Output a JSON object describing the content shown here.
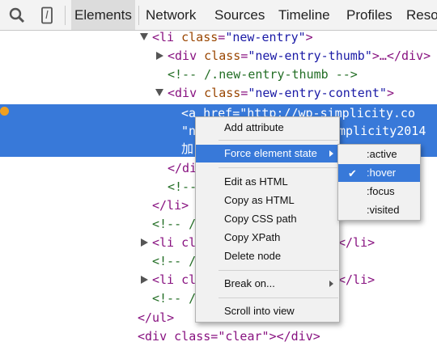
{
  "toolbar": {
    "search_icon": "search-icon",
    "device_icon": "mobile-device-icon",
    "tabs": [
      {
        "label": "Elements",
        "active": true
      },
      {
        "label": "Network"
      },
      {
        "label": "Sources"
      },
      {
        "label": "Timeline"
      },
      {
        "label": "Profiles"
      },
      {
        "label": "Reso"
      }
    ]
  },
  "tree": {
    "lines": [
      {
        "open": "<",
        "tag": "li",
        "attr": " class",
        "eq": "=",
        "val": "\"new-entry\"",
        "close": ">"
      },
      {
        "open": "<",
        "tag": "div",
        "attr": " class",
        "eq": "=",
        "val": "\"new-entry-thumb\"",
        "close": ">…</div>"
      },
      {
        "comment": "<!-- /.new-entry-thumb -->"
      },
      {
        "open": "<",
        "tag": "div",
        "attr": " class",
        "eq": "=",
        "val": "\"new-entry-content\"",
        "close": ">"
      },
      {
        "selected_1": "<a href=\"http://wp-simplicity.co",
        "selected_2": "\"n",
        "selected_2b": "mplicity2014",
        "selected_3": "加"
      },
      {
        "text": "</di"
      },
      {
        "text": "<!--"
      },
      {
        "text": "</li>"
      },
      {
        "text": "<!-- /"
      },
      {
        "text": "<li cl",
        "text_end": "</li>"
      },
      {
        "text": "<!-- /"
      },
      {
        "text": "<li cl",
        "text_end": "</li>"
      },
      {
        "text": "<!-- /"
      },
      {
        "text": "</ul>"
      },
      {
        "text": "<div class=\"clear\"></div>"
      }
    ]
  },
  "context_menu": {
    "items": [
      {
        "label": "Add attribute"
      },
      {
        "label": "Force element state",
        "submenu": true,
        "highlighted": true
      },
      {
        "label": "Edit as HTML"
      },
      {
        "label": "Copy as HTML"
      },
      {
        "label": "Copy CSS path"
      },
      {
        "label": "Copy XPath"
      },
      {
        "label": "Delete node"
      },
      {
        "label": "Break on...",
        "submenu": true
      },
      {
        "label": "Scroll into view"
      }
    ]
  },
  "state_submenu": {
    "items": [
      {
        "label": ":active",
        "checked": false
      },
      {
        "label": ":hover",
        "checked": true,
        "highlighted": true
      },
      {
        "label": ":focus",
        "checked": false
      },
      {
        "label": ":visited",
        "checked": false
      }
    ],
    "check_glyph": "✔"
  },
  "colors": {
    "selection": "#3879d9",
    "tag": "#881280",
    "attribute": "#994500",
    "value": "#1a1aa6",
    "comment": "#236e25"
  }
}
